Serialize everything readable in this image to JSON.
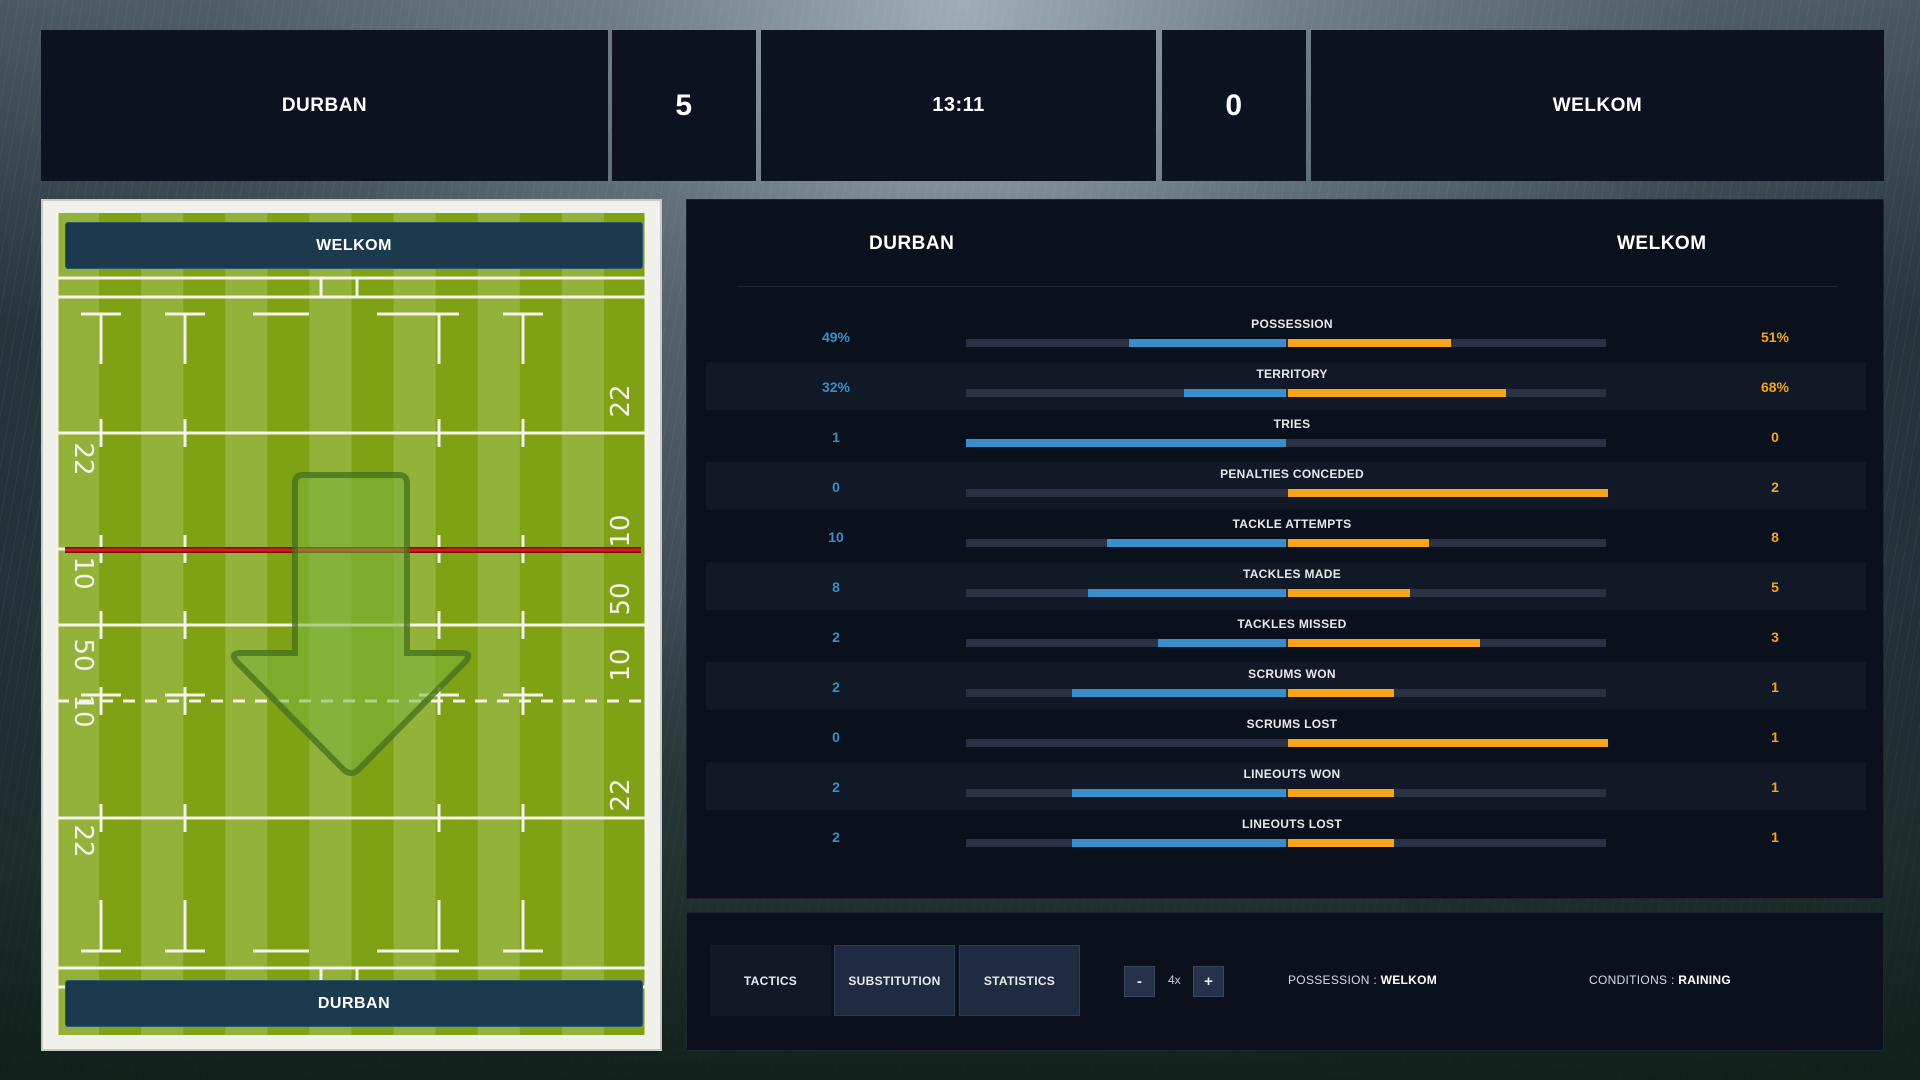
{
  "colors": {
    "home": "#3a8fcb",
    "away": "#f7a61c",
    "panel": "#0b111c",
    "pitch_light": "#93b23a",
    "pitch_dark": "#7fa214"
  },
  "scoreboard": {
    "home_team": "DURBAN",
    "home_score": "5",
    "clock": "13:11",
    "away_score": "0",
    "away_team": "WELKOM"
  },
  "pitch": {
    "top_team": "WELKOM",
    "bottom_team": "DURBAN",
    "left_markings": [
      "22",
      "10",
      "50",
      "10",
      "22"
    ],
    "right_markings": [
      "22",
      "10",
      "50",
      "10",
      "22"
    ],
    "play_direction": "down",
    "direction_icon": "down-arrow-icon"
  },
  "stats": {
    "home_header": "DURBAN",
    "away_header": "WELKOM",
    "rows": [
      {
        "label": "POSSESSION",
        "home": "49%",
        "away": "51%",
        "home_fill": 0.49,
        "away_fill": 0.51
      },
      {
        "label": "TERRITORY",
        "home": "32%",
        "away": "68%",
        "home_fill": 0.32,
        "away_fill": 0.68
      },
      {
        "label": "TRIES",
        "home": "1",
        "away": "0",
        "home_fill": 1.0,
        "away_fill": 0.0
      },
      {
        "label": "PENALTIES CONCEDED",
        "home": "0",
        "away": "2",
        "home_fill": 0.0,
        "away_fill": 1.0
      },
      {
        "label": "TACKLE ATTEMPTS",
        "home": "10",
        "away": "8",
        "home_fill": 0.56,
        "away_fill": 0.44
      },
      {
        "label": "TACKLES MADE",
        "home": "8",
        "away": "5",
        "home_fill": 0.62,
        "away_fill": 0.38
      },
      {
        "label": "TACKLES MISSED",
        "home": "2",
        "away": "3",
        "home_fill": 0.4,
        "away_fill": 0.6
      },
      {
        "label": "SCRUMS WON",
        "home": "2",
        "away": "1",
        "home_fill": 0.67,
        "away_fill": 0.33
      },
      {
        "label": "SCRUMS LOST",
        "home": "0",
        "away": "1",
        "home_fill": 0.0,
        "away_fill": 1.0
      },
      {
        "label": "LINEOUTS WON",
        "home": "2",
        "away": "1",
        "home_fill": 0.67,
        "away_fill": 0.33
      },
      {
        "label": "LINEOUTS LOST",
        "home": "2",
        "away": "1",
        "home_fill": 0.67,
        "away_fill": 0.33
      }
    ]
  },
  "controls": {
    "tactics": "TACTICS",
    "substitution": "SUBSTITUTION",
    "statistics": "STATISTICS",
    "speed_minus": "-",
    "speed_value": "4x",
    "speed_plus": "+",
    "possession_label": "POSSESSION :",
    "possession_value": "WELKOM",
    "conditions_label": "CONDITIONS :",
    "conditions_value": "RAINING"
  }
}
